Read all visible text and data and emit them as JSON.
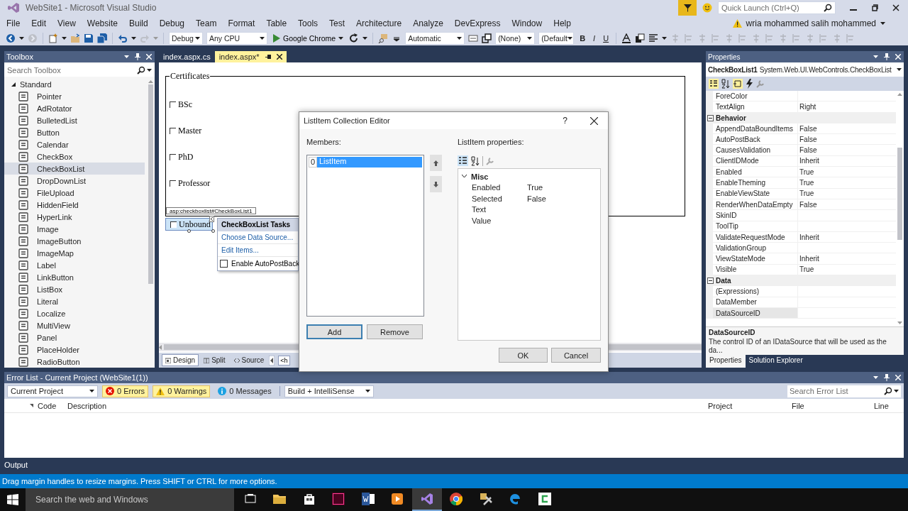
{
  "window": {
    "title": "WebSite1 - Microsoft Visual Studio",
    "quick_launch": {
      "placeholder": "Quick Launch (Ctrl+Q)"
    },
    "user": "wria mohammed salih mohammed"
  },
  "menu": [
    "File",
    "Edit",
    "View",
    "Website",
    "Build",
    "Debug",
    "Team",
    "Format",
    "Table",
    "Tools",
    "Test",
    "Architecture",
    "Analyze",
    "DevExpress",
    "Window",
    "Help"
  ],
  "toolbar": {
    "dropdowns": [
      "Debug",
      "Any CPU",
      "Automatic",
      "(None)",
      "(Default"
    ],
    "run_target": "Google Chrome",
    "format_buttons": [
      "B",
      "I",
      "U"
    ]
  },
  "toolbox": {
    "title": "Toolbox",
    "search": {
      "placeholder": "Search Toolbox"
    },
    "group": {
      "label": "Standard",
      "expanded": true
    },
    "items": [
      {
        "label": "Pointer",
        "selected": false
      },
      {
        "label": "AdRotator",
        "selected": false
      },
      {
        "label": "BulletedList",
        "selected": false
      },
      {
        "label": "Button",
        "selected": false
      },
      {
        "label": "Calendar",
        "selected": false
      },
      {
        "label": "CheckBox",
        "selected": false
      },
      {
        "label": "CheckBoxList",
        "selected": true
      },
      {
        "label": "DropDownList",
        "selected": false
      },
      {
        "label": "FileUpload",
        "selected": false
      },
      {
        "label": "HiddenField",
        "selected": false
      },
      {
        "label": "HyperLink",
        "selected": false
      },
      {
        "label": "Image",
        "selected": false
      },
      {
        "label": "ImageButton",
        "selected": false
      },
      {
        "label": "ImageMap",
        "selected": false
      },
      {
        "label": "Label",
        "selected": false
      },
      {
        "label": "LinkButton",
        "selected": false
      },
      {
        "label": "ListBox",
        "selected": false
      },
      {
        "label": "Literal",
        "selected": false
      },
      {
        "label": "Localize",
        "selected": false
      },
      {
        "label": "MultiView",
        "selected": false
      },
      {
        "label": "Panel",
        "selected": false
      },
      {
        "label": "PlaceHolder",
        "selected": false
      },
      {
        "label": "RadioButton",
        "selected": false
      }
    ]
  },
  "editor": {
    "tabs": [
      {
        "label": "index.aspx.cs",
        "selected": false
      },
      {
        "label": "index.aspx*",
        "selected": true
      }
    ],
    "design": {
      "fieldset": {
        "legend": "Certificates",
        "options": [
          {
            "label": "BSc",
            "checked": false
          },
          {
            "label": "Master",
            "checked": false
          },
          {
            "label": "PhD",
            "checked": false
          },
          {
            "label": "Professor",
            "checked": false
          }
        ]
      },
      "control_tag": "asp:checkboxlist#CheckBoxList1",
      "control": {
        "label": "Unbound",
        "checked": false,
        "selected": true
      },
      "tasks": {
        "title": "CheckBoxList Tasks",
        "links": [
          "Choose Data Source...",
          "Edit Items..."
        ],
        "autopostback": {
          "label": "Enable AutoPostBack",
          "checked": false
        }
      }
    },
    "views": [
      {
        "label": "Design",
        "selected": true
      },
      {
        "label": "Split",
        "selected": false
      },
      {
        "label": "Source",
        "selected": false
      }
    ],
    "breadcrumb": "<h"
  },
  "dialog": {
    "title": "ListItem Collection Editor",
    "help": "?",
    "members_label": "Members:",
    "members": [
      {
        "index": "0",
        "label": "ListItem",
        "selected": true
      }
    ],
    "add": "Add",
    "remove": "Remove",
    "properties_label": "ListItem properties:",
    "category": {
      "label": "Misc",
      "expanded": true
    },
    "properties": [
      {
        "name": "Enabled",
        "value": "True"
      },
      {
        "name": "Selected",
        "value": "False"
      },
      {
        "name": "Text"
      },
      {
        "name": "Value"
      }
    ],
    "ok": "OK",
    "cancel": "Cancel"
  },
  "properties": {
    "title": "Properties",
    "object": "CheckBoxList1",
    "type": "System.Web.UI.WebControls.CheckBoxList",
    "rows": [
      {
        "kind": "property",
        "name": "ForeColor",
        "selected": false
      },
      {
        "kind": "property",
        "name": "TextAlign",
        "value": "Right",
        "selected": false
      },
      {
        "kind": "category",
        "name": "Behavior",
        "expanded": true
      },
      {
        "kind": "property",
        "name": "AppendDataBoundItems",
        "value": "False",
        "selected": false
      },
      {
        "kind": "property",
        "name": "AutoPostBack",
        "value": "False",
        "selected": false
      },
      {
        "kind": "property",
        "name": "CausesValidation",
        "value": "False",
        "selected": false
      },
      {
        "kind": "property",
        "name": "ClientIDMode",
        "value": "Inherit",
        "selected": false
      },
      {
        "kind": "property",
        "name": "Enabled",
        "value": "True",
        "selected": false
      },
      {
        "kind": "property",
        "name": "EnableTheming",
        "value": "True",
        "selected": false
      },
      {
        "kind": "property",
        "name": "EnableViewState",
        "value": "True",
        "selected": false
      },
      {
        "kind": "property",
        "name": "RenderWhenDataEmpty",
        "value": "False",
        "selected": false
      },
      {
        "kind": "property",
        "name": "SkinID",
        "selected": false
      },
      {
        "kind": "property",
        "name": "ToolTip",
        "selected": false
      },
      {
        "kind": "property",
        "name": "ValidateRequestMode",
        "value": "Inherit",
        "selected": false
      },
      {
        "kind": "property",
        "name": "ValidationGroup",
        "selected": false
      },
      {
        "kind": "property",
        "name": "ViewStateMode",
        "value": "Inherit",
        "selected": false
      },
      {
        "kind": "property",
        "name": "Visible",
        "value": "True",
        "selected": false
      },
      {
        "kind": "category",
        "name": "Data",
        "expanded": true
      },
      {
        "kind": "property",
        "name": "(Expressions)",
        "selected": false
      },
      {
        "kind": "property",
        "name": "DataMember",
        "selected": false
      },
      {
        "kind": "property",
        "name": "DataSourceID",
        "selected": true
      }
    ],
    "description": {
      "title": "DataSourceID",
      "text": "The control ID of an IDataSource that will be used as the da..."
    },
    "tabs": [
      {
        "label": "Properties",
        "selected": true
      },
      {
        "label": "Solution Explorer",
        "selected": false
      }
    ]
  },
  "error_list": {
    "title": "Error List - Current Project (WebSite1(1))",
    "scope": "Current Project",
    "filters": [
      {
        "kind": "error",
        "label": "0 Errors",
        "selected": true
      },
      {
        "kind": "warning",
        "label": "0 Warnings",
        "selected": true
      },
      {
        "kind": "message",
        "label": "0 Messages",
        "selected": false
      }
    ],
    "source": "Build + IntelliSense",
    "search": {
      "placeholder": "Search Error List"
    },
    "columns": [
      "Code",
      "Description",
      "Project",
      "File",
      "Line"
    ]
  },
  "output_tab": "Output",
  "status_bar": "Drag margin handles to resize margins. Press SHIFT or CTRL for more options.",
  "taskbar": {
    "search": {
      "placeholder": "Search the web and Windows"
    },
    "apps": [
      {
        "kind": "task-view",
        "selected": false
      },
      {
        "kind": "folder",
        "selected": false
      },
      {
        "kind": "store",
        "selected": false
      },
      {
        "kind": "pink-tile",
        "selected": false
      },
      {
        "kind": "blue-tile",
        "selected": false
      },
      {
        "kind": "media",
        "selected": false
      },
      {
        "kind": "studio",
        "selected": true
      },
      {
        "kind": "chrome",
        "selected": false
      },
      {
        "kind": "tool",
        "selected": false
      },
      {
        "kind": "edge",
        "selected": false
      },
      {
        "kind": "green-tile",
        "selected": false
      }
    ]
  }
}
